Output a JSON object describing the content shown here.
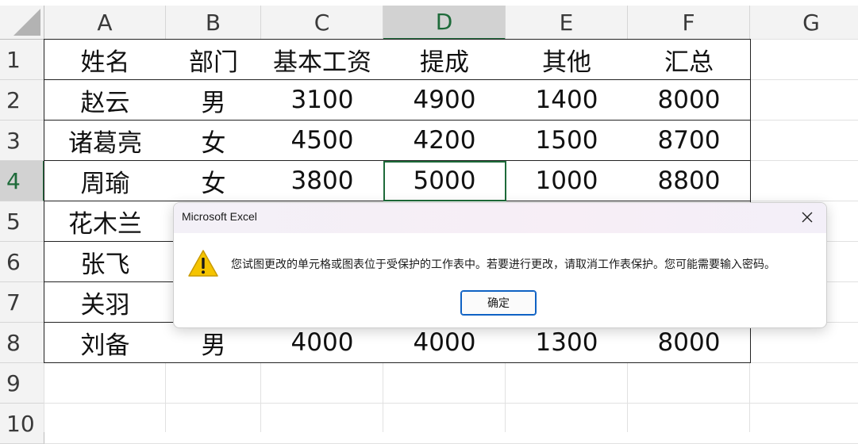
{
  "sheet": {
    "columns": [
      "A",
      "B",
      "C",
      "D",
      "E",
      "F",
      "G"
    ],
    "rows": [
      "1",
      "2",
      "3",
      "4",
      "5",
      "6",
      "7",
      "8",
      "9",
      "10"
    ],
    "selected_column": "D",
    "selected_row": "4",
    "table": [
      [
        "姓名",
        "部门",
        "基本工资",
        "提成",
        "其他",
        "汇总"
      ],
      [
        "赵云",
        "男",
        "3100",
        "4900",
        "1400",
        "8000"
      ],
      [
        "诸葛亮",
        "女",
        "4500",
        "4200",
        "1500",
        "8700"
      ],
      [
        "周瑜",
        "女",
        "3800",
        "5000",
        "1000",
        "8800"
      ],
      [
        "花木兰",
        "",
        "",
        "",
        "",
        ""
      ],
      [
        "张飞",
        "",
        "",
        "",
        "",
        ""
      ],
      [
        "关羽",
        "",
        "",
        "",
        "",
        ""
      ],
      [
        "刘备",
        "男",
        "4000",
        "4000",
        "1300",
        "8000"
      ]
    ]
  },
  "dialog": {
    "title": "Microsoft Excel",
    "message": "您试图更改的单元格或图表位于受保护的工作表中。若要进行更改，请取消工作表保护。您可能需要输入密码。",
    "ok_label": "确定",
    "icon": "warning-icon",
    "close_icon": "close-icon"
  }
}
